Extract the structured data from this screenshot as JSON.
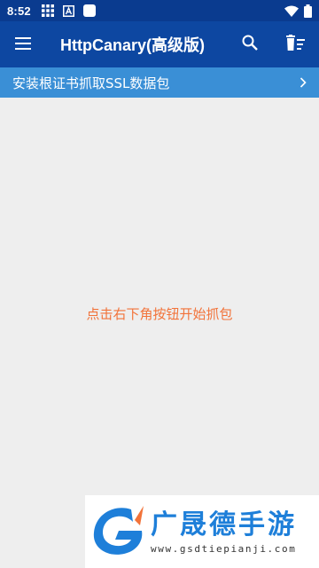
{
  "status_bar": {
    "time": "8:52",
    "left_icons": [
      "grid-icon",
      "a-box-icon",
      "square-icon"
    ],
    "right_icons": [
      "wifi-icon",
      "battery-icon"
    ]
  },
  "app_bar": {
    "menu_icon": "menu-icon",
    "title": "HttpCanary(高级版)",
    "actions": [
      "search-icon",
      "clear-list-icon"
    ]
  },
  "ssl_banner": {
    "text": "安装根证书抓取SSL数据包",
    "chevron": "chevron-right-icon"
  },
  "main": {
    "empty_hint": "点击右下角按钮开始抓包"
  },
  "watermark": {
    "name": "广晟德手游",
    "url": "www.gsdtiepianji.com"
  },
  "colors": {
    "status_bar": "#0a3b8f",
    "app_bar": "#0d47a1",
    "banner": "#3a8fd6",
    "background": "#eeeeee",
    "hint_text": "#f2733a",
    "watermark_blue": "#1e7fd9"
  }
}
